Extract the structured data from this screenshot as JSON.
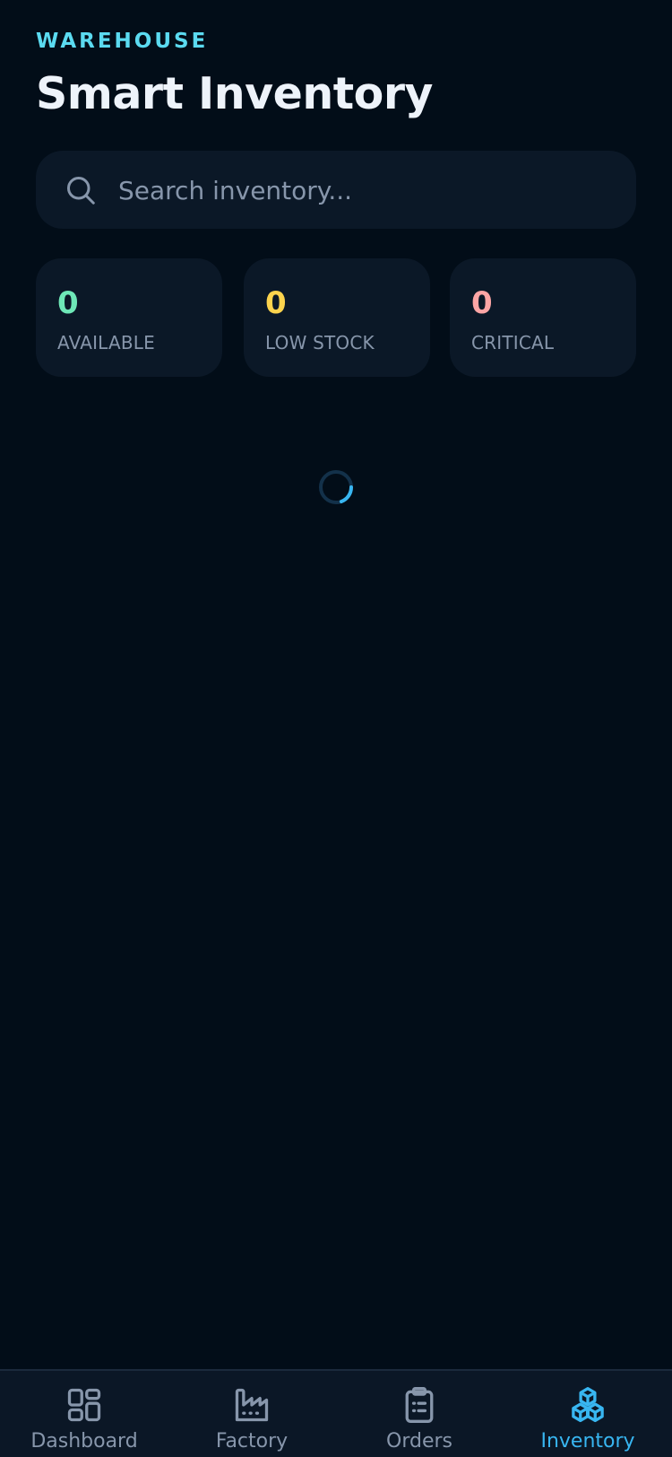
{
  "header": {
    "eyebrow": "WAREHOUSE",
    "title": "Smart Inventory"
  },
  "search": {
    "placeholder": "Search inventory...",
    "value": "",
    "icon": "search-icon"
  },
  "stats": [
    {
      "value": "0",
      "label": "AVAILABLE",
      "color": "#6ee7b7"
    },
    {
      "value": "0",
      "label": "LOW STOCK",
      "color": "#fcd34d"
    },
    {
      "value": "0",
      "label": "CRITICAL",
      "color": "#fca5a5"
    }
  ],
  "loading": {
    "icon": "loading-spinner-icon",
    "accent": "#38b6f1"
  },
  "nav": {
    "items": [
      {
        "label": "Dashboard",
        "icon": "dashboard-icon",
        "active": false
      },
      {
        "label": "Factory",
        "icon": "factory-icon",
        "active": false
      },
      {
        "label": "Orders",
        "icon": "clipboard-icon",
        "active": false
      },
      {
        "label": "Inventory",
        "icon": "cubes-icon",
        "active": true
      }
    ],
    "active_color": "#38b6f1",
    "inactive_color": "#8796ab"
  },
  "colors": {
    "background": "#020d18",
    "surface": "#0b1827",
    "accent": "#5bdaf0"
  }
}
